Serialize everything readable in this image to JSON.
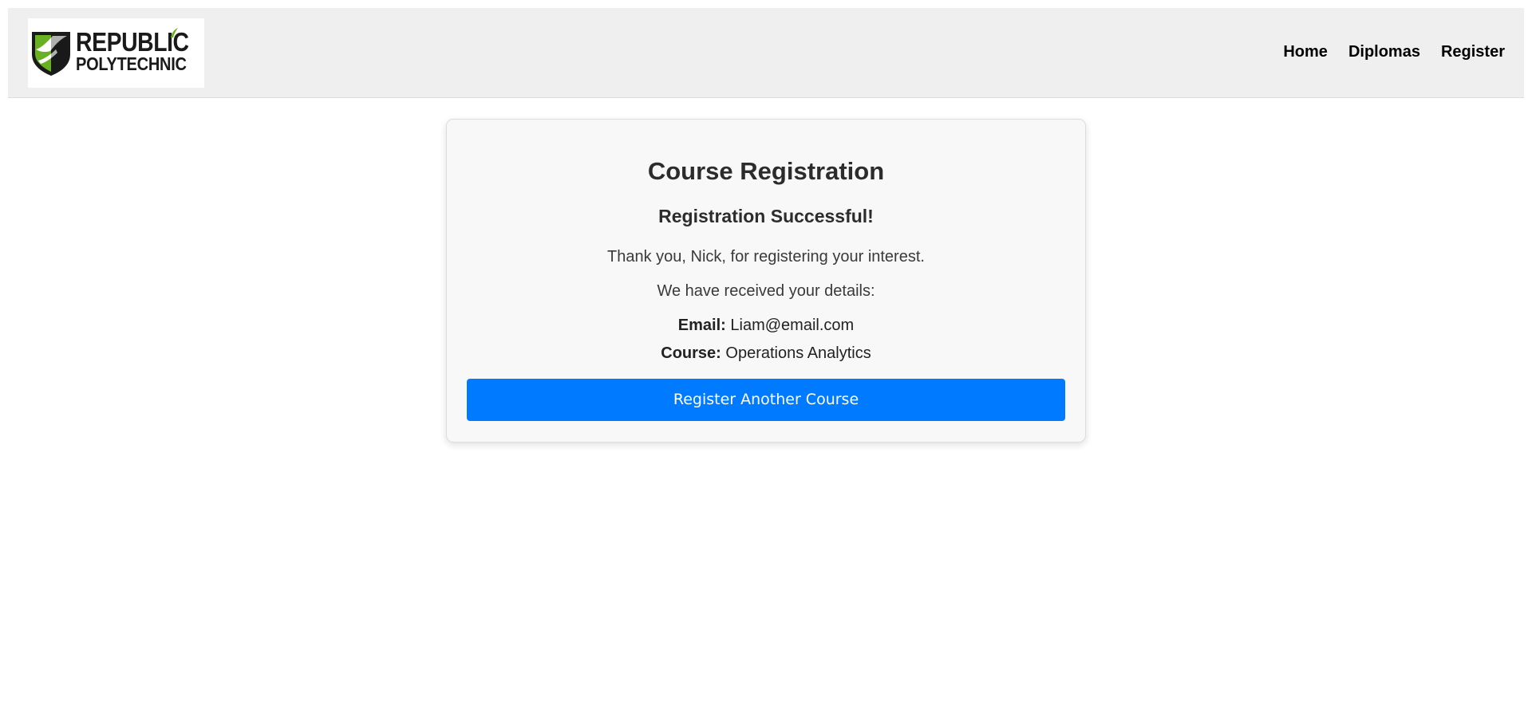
{
  "header": {
    "logo": {
      "line1": "REPUBLIC",
      "line2": "POLYTECHNIC",
      "icon": "republic-polytechnic-shield-icon",
      "colors": {
        "green": "#6ab023",
        "black": "#1a1a1a"
      }
    },
    "nav": [
      {
        "label": "Home"
      },
      {
        "label": "Diplomas"
      },
      {
        "label": "Register"
      }
    ]
  },
  "card": {
    "title": "Course Registration",
    "subtitle": "Registration Successful!",
    "thanks": "Thank you, Nick, for registering your interest.",
    "received": "We have received your details:",
    "email_label": "Email:",
    "email_value": "Liam@email.com",
    "course_label": "Course:",
    "course_value": "Operations Analytics",
    "button_label": "Register Another Course"
  },
  "colors": {
    "header_bg": "#efefef",
    "card_bg": "#f8f8f8",
    "button_bg": "#007bff"
  }
}
